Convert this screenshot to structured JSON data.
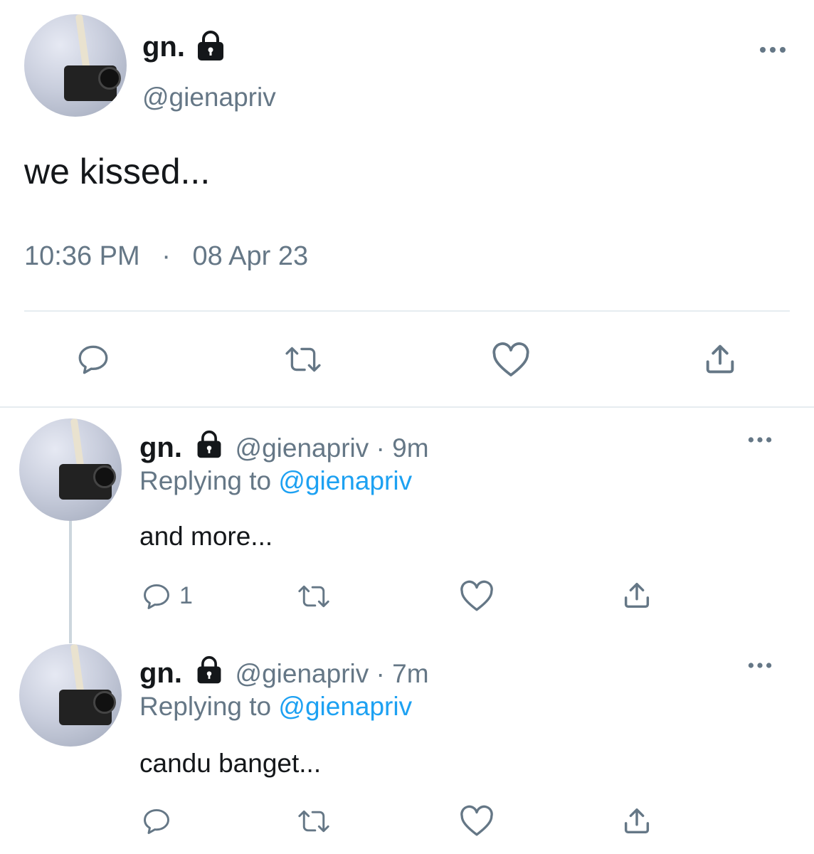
{
  "main_tweet": {
    "display_name": "gn.",
    "handle": "@gienapriv",
    "text": "we kissed...",
    "time": "10:36 PM",
    "separator": "·",
    "date": "08 Apr 23"
  },
  "replies": [
    {
      "display_name": "gn.",
      "handle": "@gienapriv",
      "dot": "·",
      "age": "9m",
      "replying_prefix": "Replying to",
      "replying_to": "@gienapriv",
      "text": "and more...",
      "reply_count": "1"
    },
    {
      "display_name": "gn.",
      "handle": "@gienapriv",
      "dot": "·",
      "age": "7m",
      "replying_prefix": "Replying to",
      "replying_to": "@gienapriv",
      "text": "candu banget...",
      "reply_count": ""
    }
  ],
  "colors": {
    "text": "#14171a",
    "muted": "#657786",
    "link": "#1da1f2",
    "divider": "#e6ecf0"
  },
  "icons": [
    "lock-icon",
    "more-icon",
    "reply-icon",
    "retweet-icon",
    "like-icon",
    "share-icon"
  ]
}
